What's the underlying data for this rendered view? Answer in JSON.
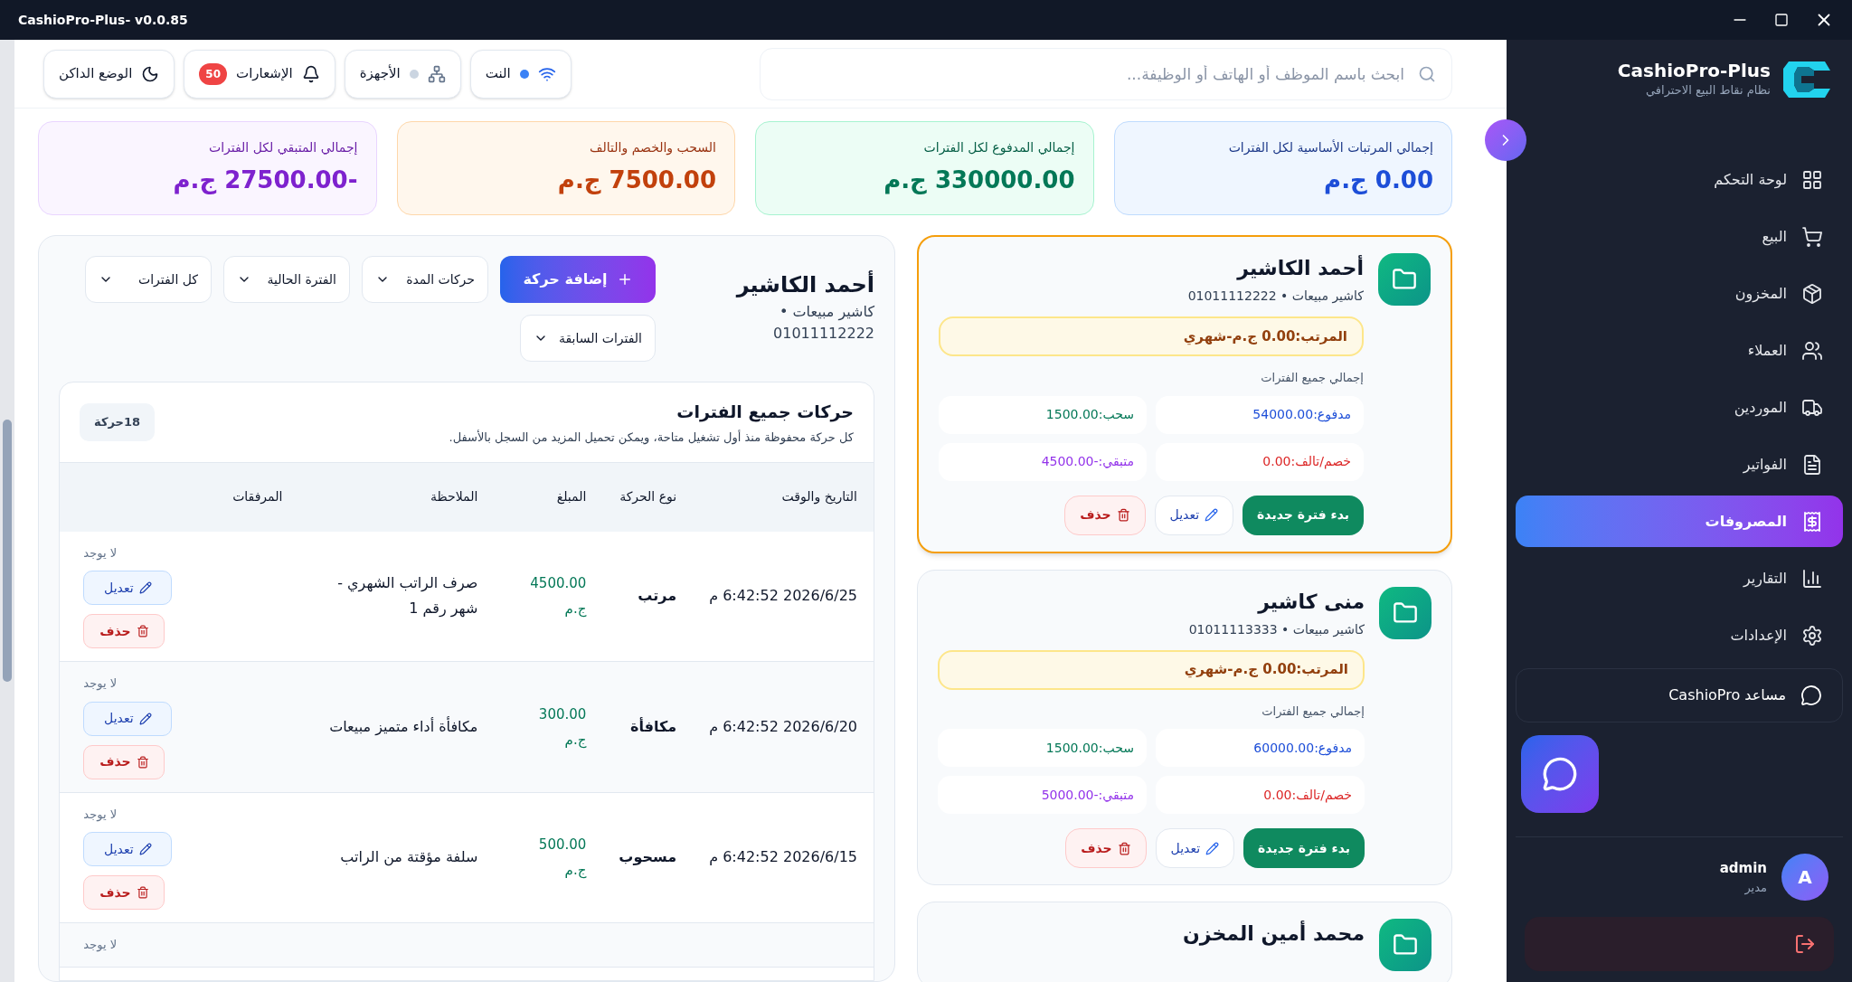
{
  "window": {
    "title": "CashioPro-Plus- v0.0.85"
  },
  "sidebar": {
    "brand": "CashioPro-Plus",
    "tagline": "نظام نقاط البيع الاحترافي",
    "items": [
      {
        "label": "لوحة التحكم",
        "selected": false
      },
      {
        "label": "البيع",
        "selected": false
      },
      {
        "label": "المخزون",
        "selected": false
      },
      {
        "label": "العملاء",
        "selected": false
      },
      {
        "label": "الموردين",
        "selected": false
      },
      {
        "label": "الفواتير",
        "selected": false
      },
      {
        "label": "المصروفات",
        "selected": true
      },
      {
        "label": "التقارير",
        "selected": false
      },
      {
        "label": "الإعدادات",
        "selected": false
      }
    ],
    "assistant": "مساعد CashioPro",
    "user": {
      "initial": "A",
      "name": "admin",
      "role": "مدير"
    }
  },
  "topbar": {
    "search": {
      "placeholder": "ابحث باسم الموظف أو الهاتف أو الوظيفة..."
    },
    "chips": [
      {
        "kind": "network",
        "label": "النت",
        "connected": true
      },
      {
        "kind": "devices",
        "label": "الأجهزة",
        "connected": false
      },
      {
        "kind": "notifications",
        "label": "الإشعارات",
        "count": "50"
      },
      {
        "kind": "theme",
        "label": "الوضع الداكن"
      }
    ]
  },
  "stats": [
    {
      "kind": "blue",
      "title": "إجمالي المرتبات الأساسية لكل الفترات",
      "value": "0.00 ج.م"
    },
    {
      "kind": "green",
      "title": "إجمالي المدفوع لكل الفترات",
      "value": "330000.00 ج.م"
    },
    {
      "kind": "orange",
      "title": "السحب والخصم والتالف",
      "value": "7500.00 ج.م"
    },
    {
      "kind": "purple",
      "title": "إجمالي المتبقي لكل الفترات",
      "value": "-27500.00 ج.م"
    }
  ],
  "employees": [
    {
      "name": "أحمد الكاشير",
      "subtitle": "كاشير مبيعات • 01011112222",
      "selected": true,
      "salary": "المرتب:0.00 ج.م-شهري",
      "totals_label": "إجمالي جميع الفترات",
      "paid": "مدفوع:54000.00",
      "withdrawn": "سحب:1500.00",
      "deduction": "خصم/تالف:0.00",
      "remaining": "متبقي:-4500.00",
      "actions": [
        "بدء فترة جديدة",
        "تعديل",
        "حذف"
      ]
    },
    {
      "name": "منى كاشير",
      "subtitle": "كاشير مبيعات • 01011113333",
      "selected": false,
      "salary": "المرتب:0.00 ج.م-شهري",
      "totals_label": "إجمالي جميع الفترات",
      "paid": "مدفوع:60000.00",
      "withdrawn": "سحب:1500.00",
      "deduction": "خصم/تالف:0.00",
      "remaining": "متبقي:-5000.00",
      "actions": [
        "بدء فترة جديدة",
        "تعديل",
        "حذف"
      ]
    },
    {
      "name": "محمد أمين المخزن",
      "selected": false
    }
  ],
  "detail": {
    "name": "أحمد الكاشير",
    "subtitle": "كاشير مبيعات • 01011112222",
    "buttons": [
      {
        "kind": "primary",
        "label": "إضافة حركة"
      },
      {
        "kind": "dropdown",
        "label": "حركات المدة"
      },
      {
        "kind": "dropdown",
        "label": "الفترة الحالية"
      },
      {
        "kind": "dropdown",
        "label": "كل الفترات"
      },
      {
        "kind": "dropdown",
        "label": "الفترات السابقة"
      }
    ],
    "movements": {
      "title": "حركات جميع الفترات",
      "description": "كل حركة محفوظة منذ أول تشغيل متاحة، ويمكن تحميل المزيد من السجل بالأسفل.",
      "count": "18حركة",
      "columns": [
        "التاريخ والوقت",
        "نوع الحركة",
        "المبلغ",
        "الملاحظة",
        "المرفقات"
      ],
      "rows": [
        {
          "datetime": "2026/6/25 6:42:52 م",
          "type": "مرتب",
          "amount": "4500.00 ج.م",
          "note": "صرف الراتب الشهري - شهر رقم 1",
          "attachments": "لا يوجد",
          "edit": "تعديل",
          "delete": "حذف"
        },
        {
          "datetime": "2026/6/20 6:42:52 م",
          "type": "مكافأة",
          "amount": "300.00 ج.م",
          "note": "مكافأة أداء متميز مبيعات",
          "attachments": "لا يوجد",
          "edit": "تعديل",
          "delete": "حذف"
        },
        {
          "datetime": "2026/6/15 6:42:52 م",
          "type": "مسحوب",
          "amount": "500.00 ج.م",
          "note": "سلفة مؤقتة من الراتب",
          "attachments": "لا يوجد",
          "edit": "تعديل",
          "delete": "حذف"
        },
        {
          "attachments": "لا يوجد"
        }
      ]
    }
  }
}
